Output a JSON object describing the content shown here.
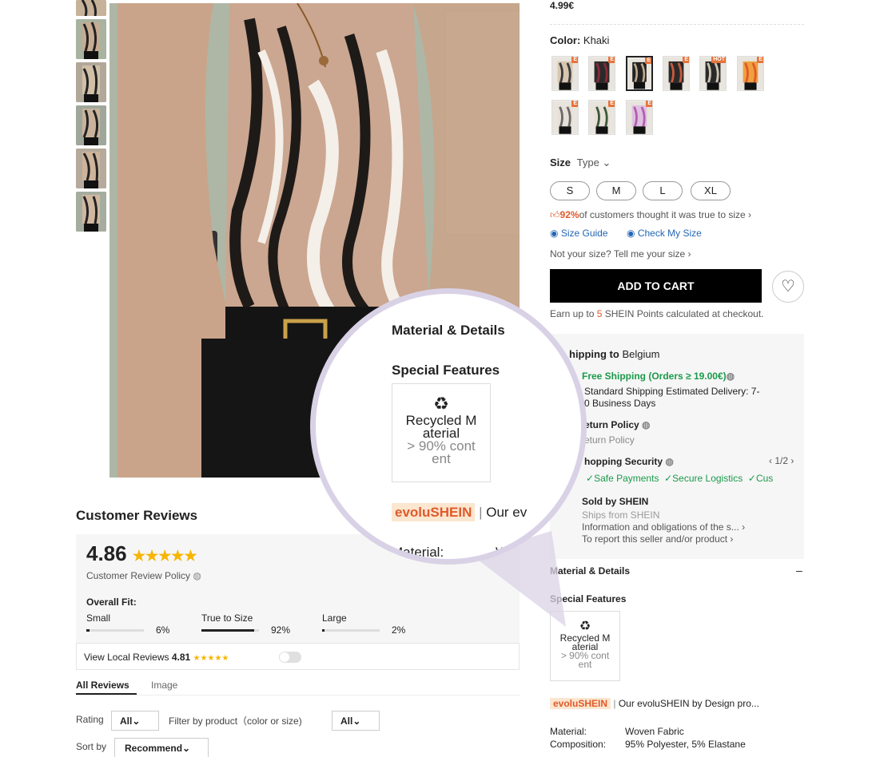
{
  "price": {
    "value": "4.99€"
  },
  "color": {
    "label": "Color:",
    "value": "Khaki",
    "swatches": [
      {
        "badge": "E",
        "c1": "#3a3a3a",
        "c2": "#d8c6b0"
      },
      {
        "badge": "E",
        "c1": "#8a2a3a",
        "c2": "#2a2a2a"
      },
      {
        "badge": "E",
        "c1": "#c2a98f",
        "c2": "#222",
        "selected": true
      },
      {
        "badge": "E",
        "c1": "#c95a3a",
        "c2": "#2a2a2a"
      },
      {
        "badge": "HOT",
        "c1": "#d0c4b4",
        "c2": "#2a2a2a"
      },
      {
        "badge": "E",
        "c1": "#e05a2a",
        "c2": "#f0a040"
      },
      {
        "badge": "E",
        "c1": "#6a6a6a",
        "c2": "#e8e0d8"
      },
      {
        "badge": "E",
        "c1": "#3a5a3a",
        "c2": "#e8e0d8"
      },
      {
        "badge": "E",
        "c1": "#b060b0",
        "c2": "#e0c0e0"
      }
    ]
  },
  "size": {
    "label": "Size",
    "type_label": "Type",
    "options": [
      "S",
      "M",
      "L",
      "XL"
    ],
    "fit_percent": "92%",
    "fit_text": "of customers thought it was true to size",
    "guide": "Size Guide",
    "check": "Check My Size",
    "not_your_size": "Not your size? Tell me your size"
  },
  "cart": {
    "add_label": "ADD TO CART",
    "points_prefix": "Earn up to ",
    "points_value": "5",
    "points_suffix": " SHEIN Points calculated at checkout."
  },
  "shipping": {
    "title": "hipping to",
    "country": "Belgium",
    "free": "Free Shipping (Orders ≥ 19.00€)",
    "standard_l1": "Standard Shipping Estimated Delivery: 7-",
    "standard_l2": "0 Business Days",
    "return_title": "eturn Policy",
    "return_sub": "eturn Policy",
    "security_title": "hopping Security",
    "security_page": "1/2",
    "sec_items": [
      "Safe Payments",
      "Secure Logistics",
      "Cus"
    ],
    "sold_title": "Sold by SHEIN",
    "ships_from": "Ships from SHEIN",
    "info": "Information and obligations of the s...",
    "report": "To report this seller and/or product"
  },
  "details": {
    "title": "Material & Details",
    "collapse": "–",
    "special": "Special Features",
    "feature_l1": "Recycled M",
    "feature_l2": "aterial",
    "feature_l3": "> 90% cont",
    "feature_l4": "ent",
    "evolu_brand": "evoluSHEIN",
    "evolu_text": "Our evoluSHEIN by Design pro...",
    "material_label": "Material:",
    "material_value": "Woven Fabric",
    "composition_label": "Composition:",
    "composition_value": "95% Polyester, 5% Elastane"
  },
  "zoom": {
    "title": "Material & Details",
    "special": "Special Features",
    "feature_l1": "Recycled M",
    "feature_l2": "aterial",
    "feature_l3": "> 90% cont",
    "feature_l4": "ent",
    "evolu_brand": "evoluSHEIN",
    "evolu_text": "Our ev",
    "material_label": "Material:",
    "material_value": "W"
  },
  "reviews": {
    "title": "Customer Reviews",
    "score": "4.86",
    "policy": "Customer Review Policy",
    "fit_title": "Overall Fit:",
    "fit": [
      {
        "label": "Small",
        "pct": "6%",
        "fill": 0.06
      },
      {
        "label": "True to Size",
        "pct": "92%",
        "fill": 0.92
      },
      {
        "label": "Large",
        "pct": "2%",
        "fill": 0.02
      }
    ],
    "local_label": "View Local Reviews",
    "local_score": "4.81",
    "tabs": [
      "All Reviews",
      "Image"
    ],
    "rating_label": "Rating",
    "rating_value": "All",
    "filter_label": "Filter by product（color or size)",
    "filter_value": "All",
    "sort_label": "Sort by",
    "sort_value": "Recommend"
  }
}
